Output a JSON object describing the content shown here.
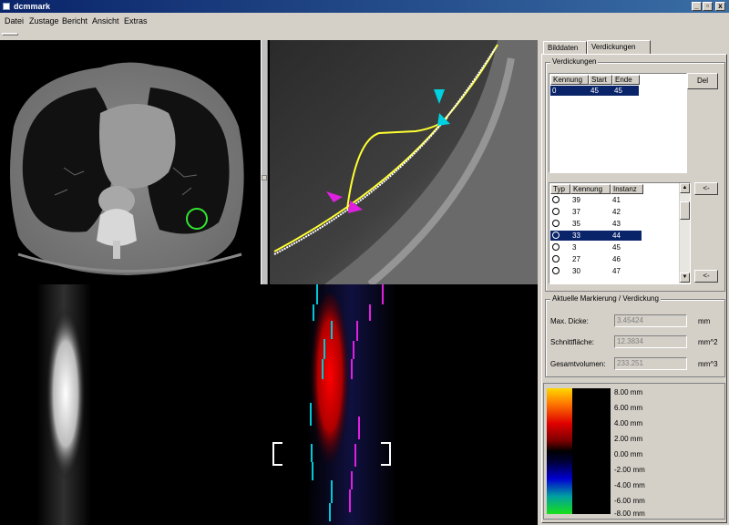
{
  "window": {
    "title": "dcmmark",
    "minimize": "_",
    "maximize": "▫",
    "close": "x"
  },
  "menu": [
    "Datei",
    "Zustage",
    "Bericht",
    "Ansicht",
    "Extras"
  ],
  "tabs": {
    "tab1": "Bilddaten",
    "tab2": "Verdickungen"
  },
  "verdickungen": {
    "legend": "Verdickungen",
    "headers": [
      "Kennung",
      "Start",
      "Ende"
    ],
    "rows": [
      {
        "kennung": "0",
        "start": "45",
        "ende": "45"
      }
    ],
    "del_button": "Del"
  },
  "instances": {
    "headers": [
      "Typ",
      "Kennung",
      "Instanz"
    ],
    "rows": [
      {
        "kennung": "39",
        "instanz": "41"
      },
      {
        "kennung": "37",
        "instanz": "42"
      },
      {
        "kennung": "35",
        "instanz": "43"
      },
      {
        "kennung": "33",
        "instanz": "44"
      },
      {
        "kennung": "3",
        "instanz": "45"
      },
      {
        "kennung": "27",
        "instanz": "46"
      },
      {
        "kennung": "30",
        "instanz": "47"
      }
    ],
    "selected_index": 3,
    "arrow_button_1": "<-",
    "arrow_button_2": "<-"
  },
  "current": {
    "legend": "Aktuelle Markierung / Verdickung",
    "max_dicke_label": "Max. Dicke:",
    "max_dicke_value": "3.45424",
    "max_dicke_unit": "mm",
    "schnittflaeche_label": "Schnittfläche:",
    "schnittflaeche_value": "12.3834",
    "schnittflaeche_unit": "mm^2",
    "gesamtvolumen_label": "Gesamtvolumen:",
    "gesamtvolumen_value": "233.251",
    "gesamtvolumen_unit": "mm^3"
  },
  "colorbar": {
    "labels": [
      "8.00 mm",
      "6.00 mm",
      "4.00 mm",
      "2.00 mm",
      "0.00 mm",
      "-2.00 mm",
      "-4.00 mm",
      "-6.00 mm",
      "-8.00 mm"
    ]
  },
  "colors": {
    "accent": "#0a246a",
    "face": "#d4d0c8",
    "marker_green": "#32e632",
    "marker_yellow": "#ffff32",
    "marker_cyan": "#00d0e0",
    "marker_magenta": "#e020e0"
  }
}
